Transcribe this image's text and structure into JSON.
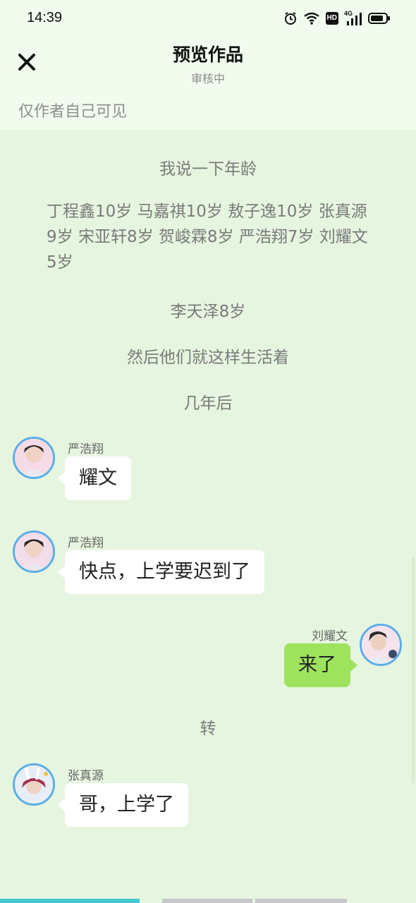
{
  "status_bar": {
    "time": "14:39",
    "icons": [
      "alarm-icon",
      "wifi-icon",
      "hd-icon",
      "4g-signal-icon",
      "battery-icon"
    ],
    "hd_label": "HD",
    "network_label": "4G"
  },
  "header": {
    "close_icon": "close-icon",
    "title": "预览作品",
    "subtitle": "审核中",
    "visibility": "仅作者自己可见"
  },
  "story": {
    "line1": "我说一下年龄",
    "para": "丁程鑫10岁  马嘉祺10岁 敖子逸10岁 张真源9岁 宋亚轩8岁 贺峻霖8岁 严浩翔7岁  刘耀文5岁",
    "line2": "李天泽8岁",
    "line3": "然后他们就这样生活着",
    "line4": "几年后",
    "line5": "转"
  },
  "messages": [
    {
      "sender": "严浩翔",
      "text": "耀文",
      "side": "left"
    },
    {
      "sender": "严浩翔",
      "text": "快点，上学要迟到了",
      "side": "left"
    },
    {
      "sender": "刘耀文",
      "text": "来了",
      "side": "right"
    },
    {
      "sender": "张真源",
      "text": "哥，上学了",
      "side": "left"
    }
  ],
  "colors": {
    "background": "#e6f5df",
    "header_background": "#f1fcee",
    "bubble_left": "#ffffff",
    "bubble_right": "#9ee35e",
    "avatar_ring": "#5aaee8",
    "progress_active": "#45c9d0",
    "progress_inactive": "#c8c8c8"
  }
}
